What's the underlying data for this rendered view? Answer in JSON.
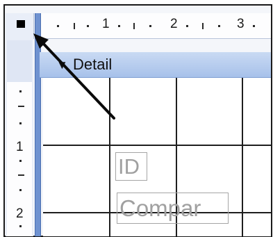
{
  "ruler": {
    "horizontal_numbers": [
      "1",
      "2",
      "3"
    ],
    "vertical_numbers": [
      "1",
      "2"
    ]
  },
  "section": {
    "label": "Detail",
    "arrow_icon": "triangle-down-icon"
  },
  "controls": {
    "id_label": "ID",
    "company_label": "Compar"
  },
  "colors": {
    "splitter": "#6f92d0",
    "section_header": "#b8cdef",
    "grid_line": "#1e1e1e",
    "control_text": "#a0a0a0"
  }
}
